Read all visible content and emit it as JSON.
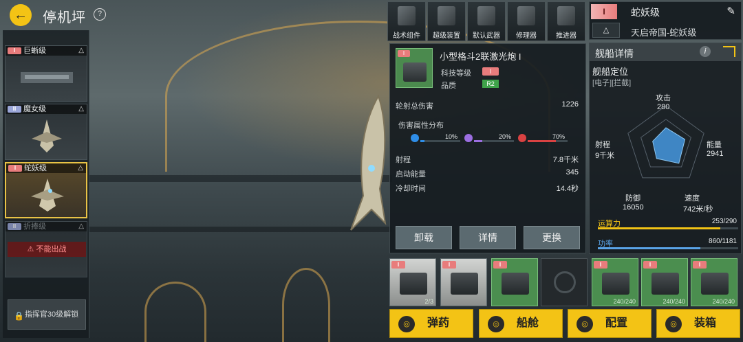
{
  "header": {
    "back_icon": "back-arrow-icon",
    "title": "停机坪",
    "help_label": "?"
  },
  "sidebar": {
    "ships": [
      {
        "rank": "I",
        "name": "巨蜥级",
        "selected": false
      },
      {
        "rank": "II",
        "name": "魔女级",
        "selected": false
      },
      {
        "rank": "I",
        "name": "蛇妖级",
        "selected": true
      },
      {
        "rank": "II",
        "name": "折捧级",
        "selected": false,
        "warning": "不能出战"
      }
    ],
    "unlock_label": "指挥官30级解锁"
  },
  "modules": [
    {
      "label": "战术组件",
      "icon": "tactical-component-icon"
    },
    {
      "label": "超级装置",
      "icon": "super-device-icon"
    },
    {
      "label": "默认武器",
      "icon": "default-weapon-icon"
    },
    {
      "label": "修理器",
      "icon": "repairer-icon"
    },
    {
      "label": "推进器",
      "icon": "thruster-icon"
    }
  ],
  "weapon": {
    "name": "小型格斗2联激光炮 I",
    "tech_label": "科技等级",
    "tech_value": "I",
    "quality_label": "品质",
    "quality_value": "R2",
    "total_damage_label": "轮射总伤害",
    "total_damage": "1226",
    "damage_dist_label": "伤害属性分布",
    "damage_dist": [
      {
        "pct": "10%",
        "color": "#2f8ee8",
        "value": 0.1
      },
      {
        "pct": "20%",
        "color": "#9b6ee0",
        "value": 0.2
      },
      {
        "pct": "70%",
        "color": "#d94242",
        "value": 0.7
      }
    ],
    "range_label": "射程",
    "range": "7.8千米",
    "energy_label": "启动能量",
    "energy": "345",
    "cooldown_label": "冷却时间",
    "cooldown": "14.4秒",
    "buttons": {
      "unload": "卸载",
      "details": "详情",
      "replace": "更换"
    }
  },
  "ship": {
    "rank": "I",
    "name": "蛇妖级",
    "faction": "天启帝国-蛇妖级"
  },
  "detail": {
    "title": "舰船详情",
    "position_label": "舰船定位",
    "position_tags": "[电子][拦截]",
    "attack_label": "攻击",
    "attack": "280",
    "range_label": "射程",
    "range": "9千米",
    "energy_label": "能量",
    "energy": "2941",
    "defense_label": "防御",
    "defense": "16050",
    "speed_label": "速度",
    "speed": "742米/秒",
    "compute_label": "运算力",
    "compute": "253/290",
    "compute_fill": 0.872,
    "power_label": "功率",
    "power": "860/1181",
    "power_fill": 0.728,
    "radar": [
      0.45,
      0.35,
      0.5,
      0.4,
      0.55
    ]
  },
  "slots": [
    {
      "rank": "I",
      "count": "2/3",
      "style": "gray"
    },
    {
      "rank": "I",
      "count": "",
      "style": "gray"
    },
    {
      "rank": "I",
      "count": "",
      "style": "green"
    },
    {
      "rank": "",
      "count": "",
      "style": "dark"
    },
    {
      "rank": "I",
      "count": "240/240",
      "style": "green"
    },
    {
      "rank": "I",
      "count": "240/240",
      "style": "green"
    },
    {
      "rank": "I",
      "count": "240/240",
      "style": "green"
    }
  ],
  "actions": [
    {
      "label": "弹药",
      "icon": "ammo-icon"
    },
    {
      "label": "船舱",
      "icon": "cabin-icon"
    },
    {
      "label": "配置",
      "icon": "config-icon"
    },
    {
      "label": "装箱",
      "icon": "crate-icon"
    }
  ]
}
